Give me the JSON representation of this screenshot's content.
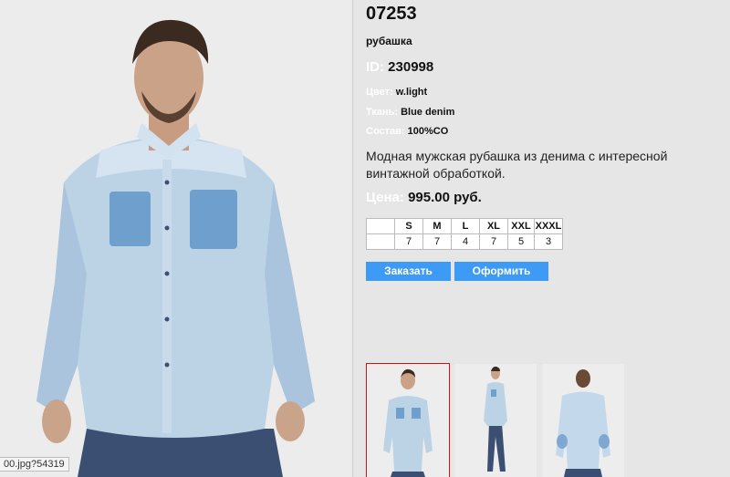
{
  "product": {
    "article": "07253",
    "type": "рубашка",
    "id_label": "ID:",
    "id_value": "230998",
    "color_label": "Цвет:",
    "color_value": "w.light",
    "fabric_label": "Ткань:",
    "fabric_value": "Blue denim",
    "composition_label": "Состав:",
    "composition_value": "100%CO",
    "description": "Модная мужская рубашка из денима с интересной винтажной обработкой.",
    "price_label": "Цена:",
    "price_value": "995.00 руб."
  },
  "sizes": {
    "headers": [
      "",
      "S",
      "M",
      "L",
      "XL",
      "XXL",
      "XXXL"
    ],
    "quantities": [
      "",
      "7",
      "7",
      "4",
      "7",
      "5",
      "3"
    ]
  },
  "buttons": {
    "order": "Заказать",
    "checkout": "Оформить"
  },
  "status_url": "00.jpg?54319",
  "colors": {
    "button_blue": "#3d9bf5",
    "selected_thumb_border": "#c81414"
  }
}
